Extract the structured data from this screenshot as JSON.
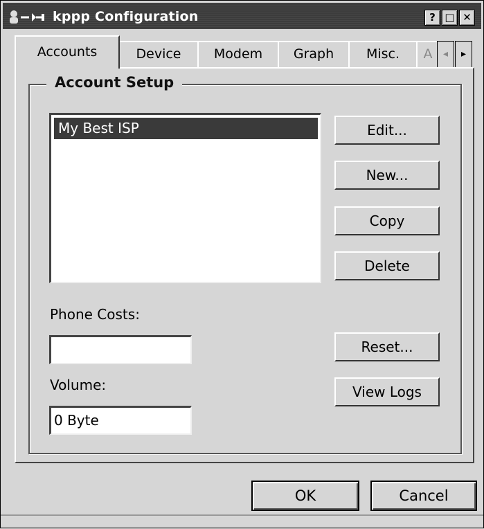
{
  "window": {
    "title": "kppp Configuration"
  },
  "titlebar_buttons": {
    "help": "?",
    "maximize": "□",
    "close": "✕"
  },
  "tabs": [
    {
      "label": "Accounts",
      "active": true
    },
    {
      "label": "Device",
      "active": false
    },
    {
      "label": "Modem",
      "active": false
    },
    {
      "label": "Graph",
      "active": false
    },
    {
      "label": "Misc.",
      "active": false
    },
    {
      "label": "A",
      "active": false
    }
  ],
  "tab_scroll": {
    "left": "◂",
    "right": "▸"
  },
  "account_setup": {
    "title": "Account Setup",
    "accounts": [
      {
        "name": "My Best ISP",
        "selected": true
      }
    ],
    "buttons": {
      "edit": "Edit...",
      "new": "New...",
      "copy": "Copy",
      "delete": "Delete",
      "reset": "Reset...",
      "view_logs": "View Logs"
    },
    "phone_costs": {
      "label": "Phone Costs:",
      "value": ""
    },
    "volume": {
      "label": "Volume:",
      "value": "0 Byte"
    }
  },
  "dialog_buttons": {
    "ok": "OK",
    "cancel": "Cancel"
  }
}
